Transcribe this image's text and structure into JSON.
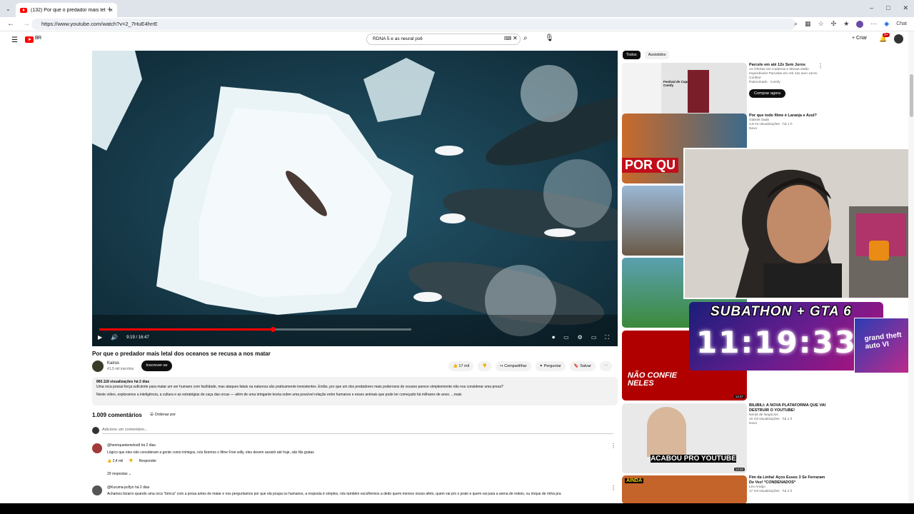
{
  "browser": {
    "tab_title": "(132) Por que o predador mais letal...",
    "tab_close": "×",
    "new_tab": "+",
    "url": "https://www.youtube.com/watch?v=2_7HuE4hrrE",
    "chat_label": "Chat",
    "nav": [
      "←",
      "→",
      "↻"
    ]
  },
  "header": {
    "logo_text": "BR",
    "search_value": "RDNA 5 e as neural ps6",
    "create_label": "+ Criar",
    "notif_badge": "9+"
  },
  "player": {
    "time": "9:19 / 16:47",
    "progress": 0.5556
  },
  "video": {
    "title": "Por que o predador mais letal dos oceanos se recusa a nos matar",
    "channel": "Kairus",
    "subs": "41,5 mil inscritos",
    "subscribe_label": "Inscrever-se",
    "likes": "17 mil",
    "share_label": "Compartilhar",
    "ask_label": "Perguntar",
    "save_label": "Salvar",
    "desc_meta": "860.118 visualizações  há 2 dias",
    "desc_line1": "Uma orca possui força suficiente para matar um ser humano com facilidade, mas ataques fatais na natureza são praticamente inexistentes. Então, por que um dos predadores mais poderosos do oceano parece simplesmente não nos considerar uma presa?",
    "desc_line2": "Neste vídeo, exploramos a inteligência, a cultura e as estratégias de caça das orcas — além de uma intrigante teoria sobre uma possível relação entre humanos e esses animais que pode ter começado há milhares de anos.  ...mais"
  },
  "comments": {
    "count_label": "1.009 comentários",
    "sort_label": "Ordenar por",
    "add_placeholder": "Adicione um comentário...",
    "items": [
      {
        "user": "@henriquedemelos8  há 2 dias",
        "text": "Lógico que eles não consideram a gente como inimigos, nós fizemos o filme Free willy, eles devem assistir até hoje, são fãs gratas",
        "likes": "2,4 mil",
        "reply_label": "Responder",
        "replies": "29 respostas"
      },
      {
        "user": "@Kuruma-pc8yn  há 2 dias",
        "text": "Achamos bizarro quando uma orca \"brinca\" com a presa antes de matar e nos perguntamos por que ela poupa os humanos, a resposta é simples, nós também escolhemos a dedo quem merece nosso afeto, quem vai pro o prato e quem vai para a arena de rodeio, ou rinque de rinha pra"
      }
    ]
  },
  "sidebar": {
    "chips": [
      "Todos",
      "Assistidos"
    ],
    "items": [
      {
        "title": "Parcele em até 12x Sem Juros",
        "sub1": "As Ofertas em Cadeiras e Mesas estão Imperdíveis! Parcelas em Até 12x sem Juros. Confira!",
        "sub2": "Patrocinado · Comfy",
        "cta": "Comprar agora",
        "thumb": "Festival de Cupons Comfy"
      },
      {
        "title": "Por que todo filme é Laranja e Azul?",
        "sub1": "Gabriel Saab",
        "sub2": "4,9 mi visualizações · há 1 h",
        "sub3": "Novo",
        "thumb": "POR QU"
      },
      {
        "title": "",
        "sub1": "",
        "sub2": ""
      },
      {
        "title": "",
        "sub1": "",
        "sub2": ""
      },
      {
        "title": "",
        "sub1": "",
        "sub2": "",
        "thumb": "NÃO CONFIE NELES",
        "dur": "13:27"
      },
      {
        "title": "BILIBILI: A NOVA PLATAFORMA QUE VAI DESTRUIR O YOUTUBE!",
        "sub1": "Nerds de Negócios",
        "sub2": "10 mil visualizações · há 1 h",
        "sub3": "Novo",
        "thumb": "ACABOU PRO YOUTUBE",
        "dur": "13:22"
      },
      {
        "title": "Fim da Linha! Aços Esses 3 Se Ferraram De Vez! *CONDENADOS*",
        "sub1": "Léo Araújo",
        "sub2": "17 mil visualizações · há 2 h",
        "thumb": "AINDA"
      }
    ]
  },
  "overlay": {
    "subathon": "SUBATHON + GTA 6",
    "timer": "11:19:33",
    "gta_label": "grand theft auto VI"
  }
}
